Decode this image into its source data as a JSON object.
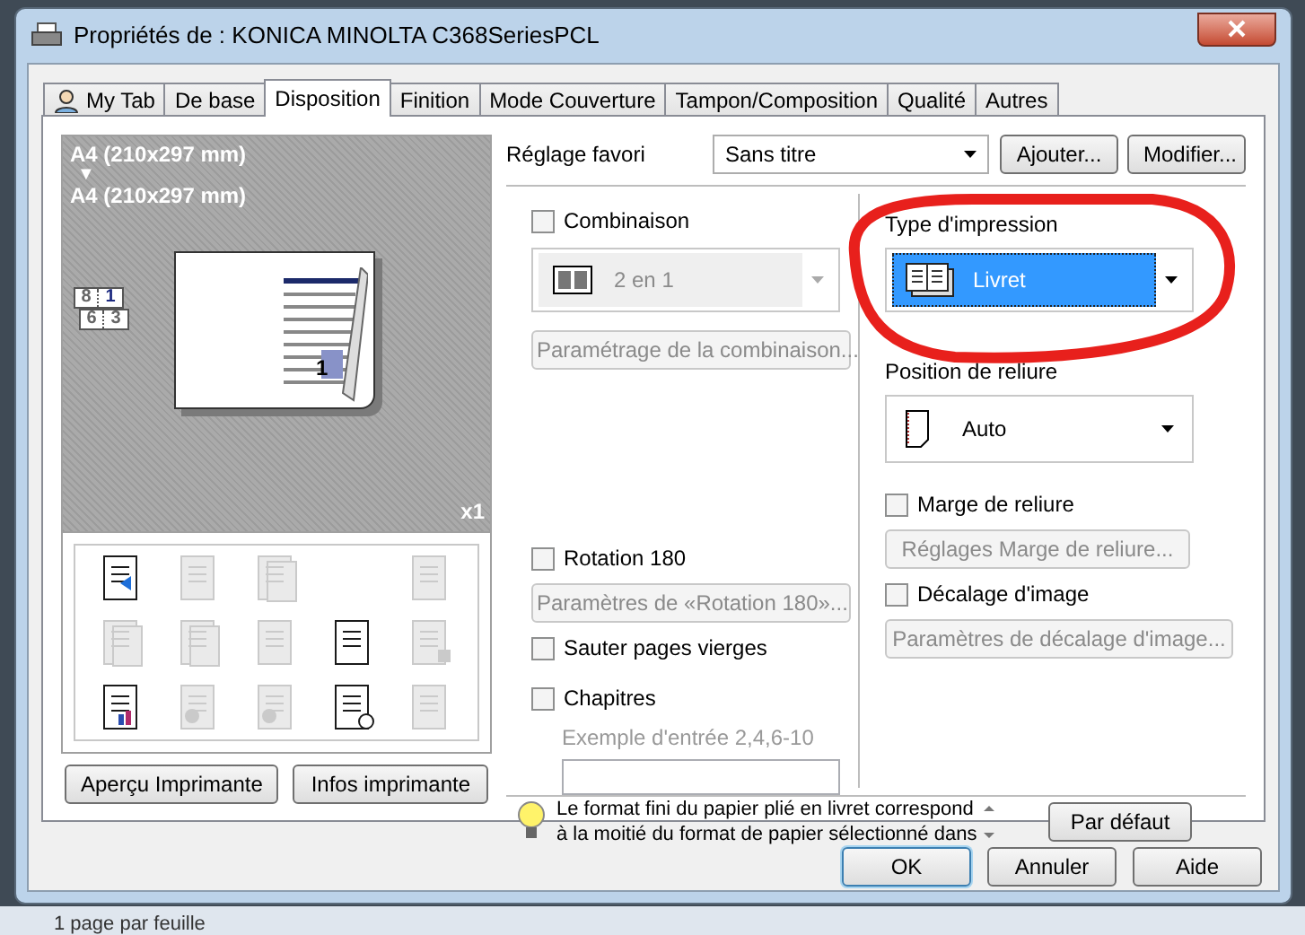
{
  "window": {
    "title": "Propriétés de : KONICA MINOLTA C368SeriesPCL"
  },
  "tabs": [
    {
      "label": "My Tab",
      "selected": false,
      "kind": "person"
    },
    {
      "label": "De base",
      "selected": false
    },
    {
      "label": "Disposition",
      "selected": true
    },
    {
      "label": "Finition",
      "selected": false
    },
    {
      "label": "Mode Couverture",
      "selected": false
    },
    {
      "label": "Tampon/Composition",
      "selected": false
    },
    {
      "label": "Qualité",
      "selected": false
    },
    {
      "label": "Autres",
      "selected": false
    }
  ],
  "preview": {
    "paper_in": "A4 (210x297 mm)",
    "arrow": "▼",
    "paper_out": "A4 (210x297 mm)",
    "page_order": [
      "8",
      "1",
      "6",
      "3"
    ],
    "page_number": "1",
    "copies": "x1"
  },
  "function_icons": [
    {
      "kind": "output",
      "disabled": false
    },
    {
      "kind": "grid",
      "disabled": true
    },
    {
      "kind": "pages",
      "disabled": true
    },
    {
      "kind": "empty"
    },
    {
      "kind": "rotate",
      "disabled": true
    },
    {
      "kind": "stack",
      "disabled": true
    },
    {
      "kind": "pages",
      "disabled": true
    },
    {
      "kind": "letter",
      "disabled": true
    },
    {
      "kind": "watermark",
      "disabled": false
    },
    {
      "kind": "lock",
      "disabled": true
    },
    {
      "kind": "chart",
      "disabled": false
    },
    {
      "kind": "person",
      "disabled": true
    },
    {
      "kind": "person",
      "disabled": true
    },
    {
      "kind": "clock",
      "disabled": false
    },
    {
      "kind": "grid",
      "disabled": true
    }
  ],
  "preview_buttons": [
    "Aperçu Imprimante",
    "Infos imprimante"
  ],
  "favorite": {
    "label": "Réglage favori",
    "value": "Sans titre",
    "buttons": [
      "Ajouter...",
      "Modifier..."
    ]
  },
  "combination": {
    "label": "Combinaison",
    "checked": false,
    "value": "2 en 1",
    "disabled": true,
    "button": "Paramétrage de la combinaison..."
  },
  "rotation": {
    "label": "Rotation 180",
    "checked": false,
    "button": "Paramètres de «Rotation 180»..."
  },
  "skip_blank": {
    "label": "Sauter pages vierges",
    "checked": false
  },
  "chapters": {
    "label": "Chapitres",
    "checked": false,
    "hint": "Exemple d'entrée 2,4,6-10"
  },
  "print_type": {
    "label": "Type d'impression",
    "value": "Livret",
    "selected": true
  },
  "binding_position": {
    "label": "Position de reliure",
    "value": "Auto"
  },
  "binding_margin": {
    "label": "Marge de reliure",
    "checked": false,
    "button": "Réglages Marge de reliure..."
  },
  "image_shift": {
    "label": "Décalage d'image",
    "checked": false,
    "button": "Paramètres de décalage d'image..."
  },
  "hint": {
    "lines": [
      "Le format fini du papier plié en livret correspond",
      "à la moitié du format de papier sélectionné dans"
    ]
  },
  "default_button": "Par défaut",
  "dialog_buttons": [
    {
      "label": "OK",
      "selected": true
    },
    {
      "label": "Annuler",
      "selected": false
    },
    {
      "label": "Aide",
      "selected": false
    }
  ],
  "background_text": "1 page par feuille"
}
